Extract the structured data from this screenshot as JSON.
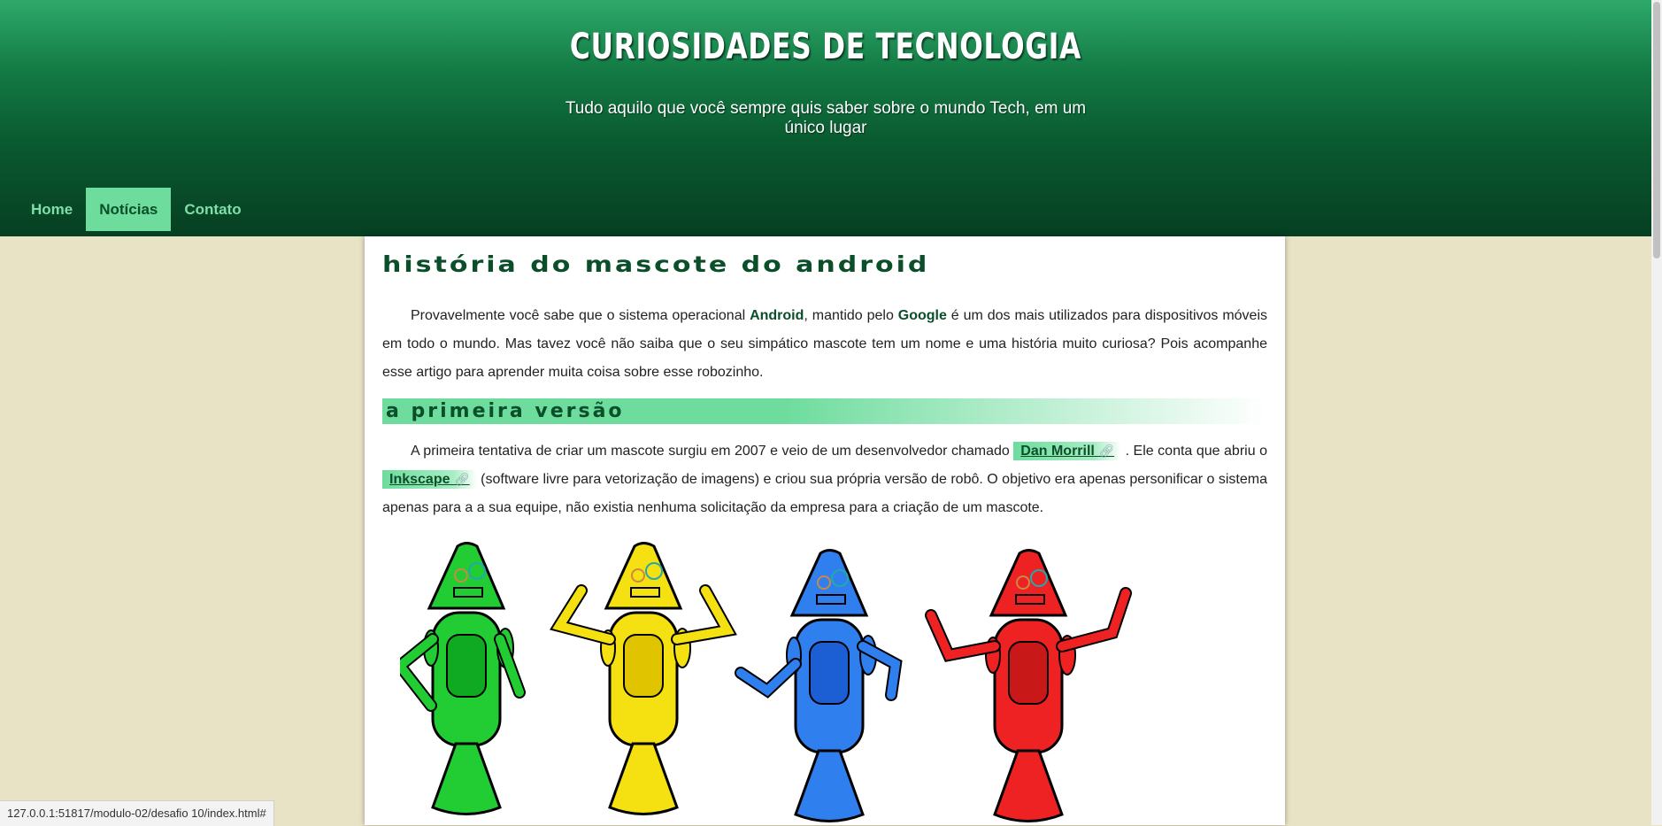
{
  "header": {
    "title": "CURIOSIDADES DE TECNOLOGIA",
    "subtitle": "Tudo aquilo que você sempre quis saber sobre o mundo Tech, em um único lugar"
  },
  "nav": {
    "items": [
      {
        "label": "Home"
      },
      {
        "label": "Notícias"
      },
      {
        "label": "Contato"
      }
    ]
  },
  "article": {
    "title": "História do mascote do Android",
    "intro": {
      "t1": "Provavelmente você sabe que o sistema operacional ",
      "b1": "Android",
      "t2": ", mantido pelo ",
      "b2": "Google",
      "t3": " é um dos mais utilizados para dispositivos móveis em todo o mundo. Mas tavez você não saiba que o seu simpático mascote tem um nome e uma história muito curiosa? Pois acompanhe esse artigo para aprender muita coisa sobre esse robozinho."
    },
    "section1": {
      "title": "A primeira versão",
      "t1": "A primeira tentativa de criar um mascote surgiu em 2007 e veio de um desenvolvedor chamado ",
      "link1": "Dan Morrill",
      "t2": " . Ele conta que abriu o ",
      "link2": "Inkscape",
      "t3": " (software livre para vetorização de imagens) e criou sua própria versão de robô. O objetivo era apenas personificar o sistema apenas para a a sua equipe, não existia nenhuma solicitação da empresa para a criação de um mascote."
    },
    "robots": {
      "colors": [
        "#22cc33",
        "#f5e011",
        "#2f7fee",
        "#ee2222"
      ],
      "dark": [
        "#0faa22",
        "#e0c400",
        "#1c5fd4",
        "#c81818"
      ]
    }
  },
  "status": {
    "url": "127.0.0.1:51817/modulo-02/desafio 10/index.html#"
  },
  "theme": {
    "accent": "#6ddc9d",
    "dark_green": "#0a4f2a",
    "background": "#e9e3c6"
  }
}
